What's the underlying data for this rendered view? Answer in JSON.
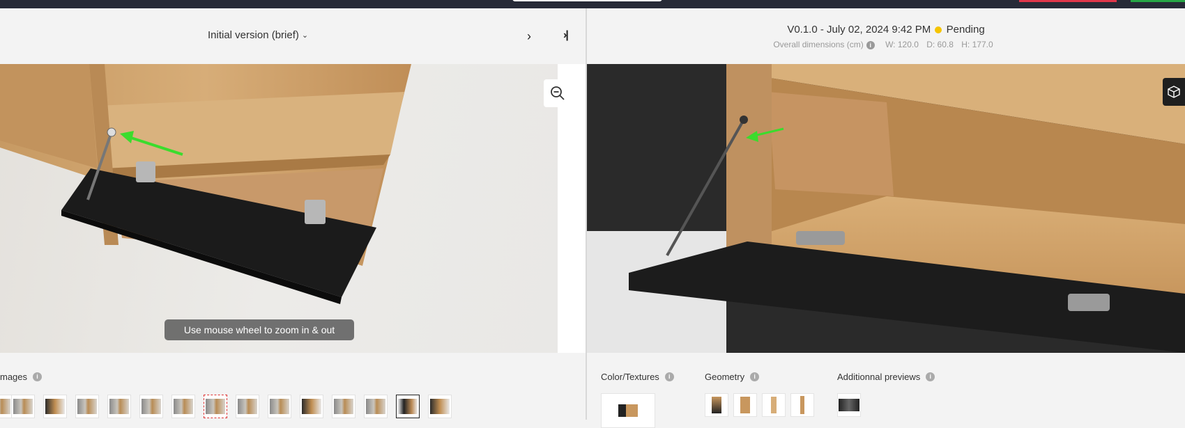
{
  "left_panel": {
    "version_label": "Initial version (brief)",
    "next_icon": "chevron-right-icon",
    "last_icon": "skip-to-last-icon",
    "zoom_icon": "zoom-out-icon",
    "zoom_hint": "Use mouse wheel to zoom in & out",
    "images_label": "mages",
    "image_thumbs": [
      "t1",
      "t2",
      "t3",
      "t4",
      "t5",
      "t6",
      "t7",
      "t8",
      "t9",
      "t10",
      "t11",
      "t12",
      "t13",
      "t14",
      "t15"
    ]
  },
  "right_panel": {
    "version": "V0.1.0 - July 02, 2024 9:42 PM",
    "status": "Pending",
    "status_color": "#f5c400",
    "dimensions_label": "Overall dimensions (cm)",
    "width": "W: 120.0",
    "depth": "D: 60.8",
    "height": "H: 177.0",
    "cube_icon": "3d-view-icon",
    "color_textures_label": "Color/Textures",
    "geometry_label": "Geometry",
    "additional_previews_label": "Additionnal previews"
  }
}
